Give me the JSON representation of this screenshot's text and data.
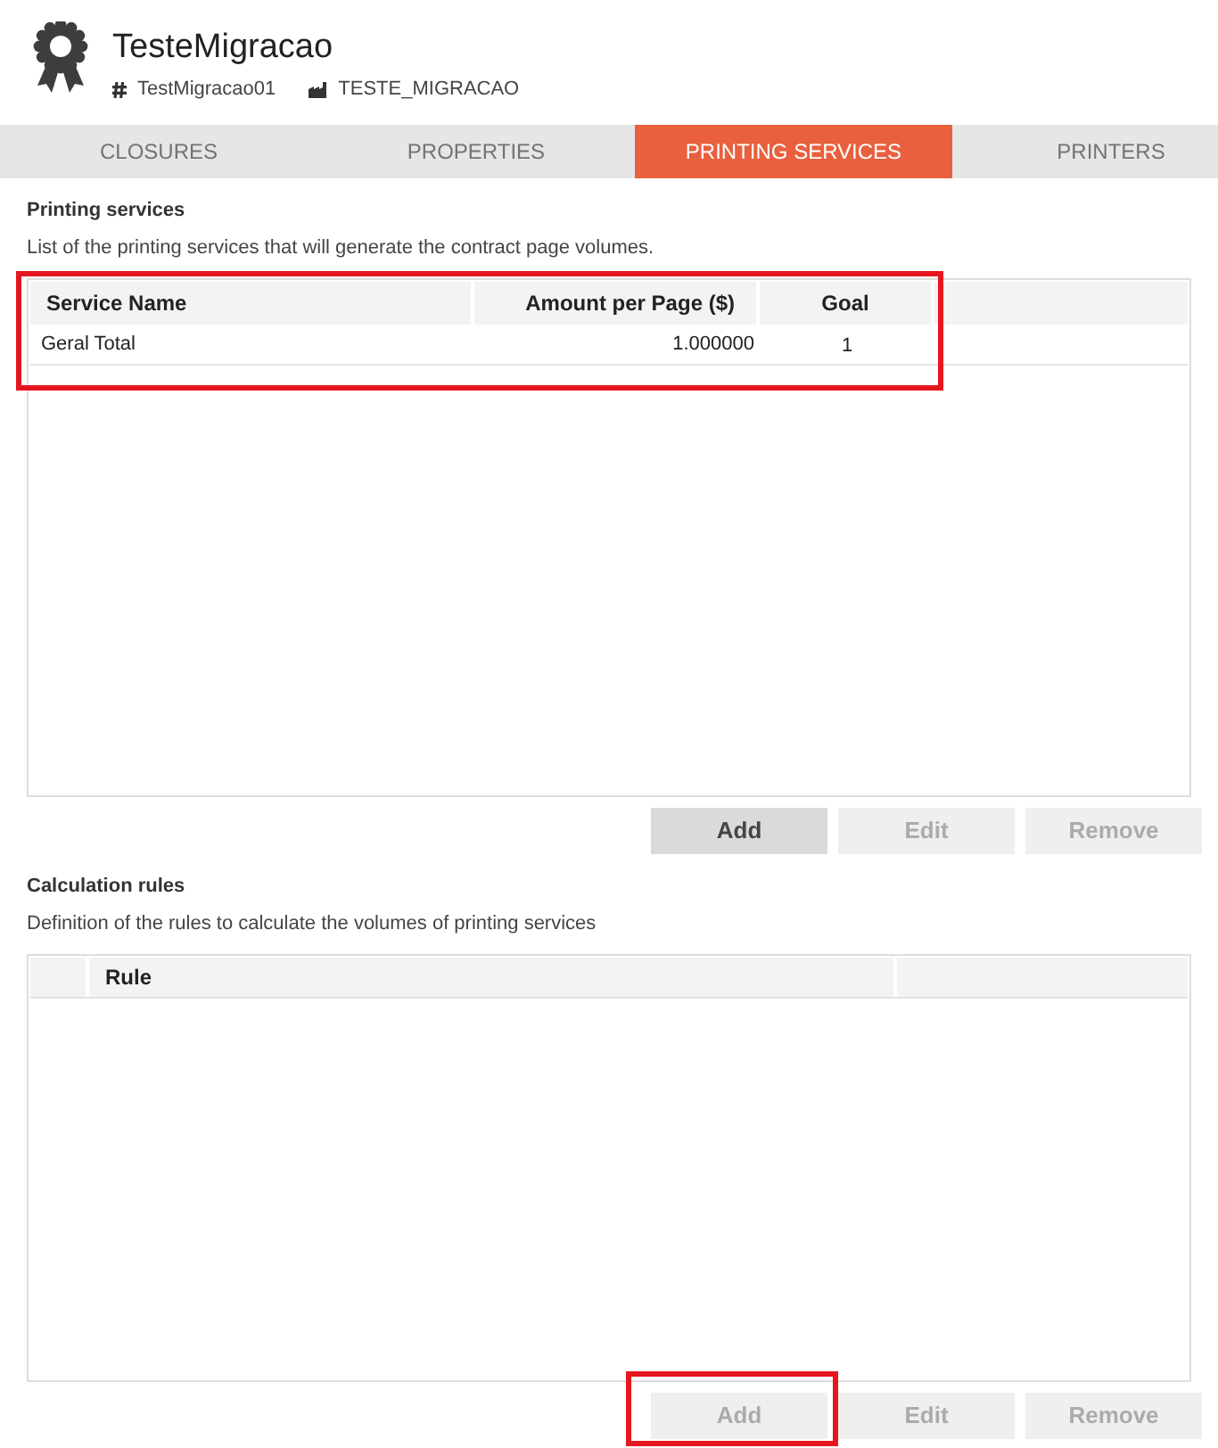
{
  "header": {
    "title": "TesteMigracao",
    "code": "TestMigracao01",
    "company": "TESTE_MIGRACAO"
  },
  "tabs": [
    {
      "label": "CLOSURES",
      "selected": false
    },
    {
      "label": "PROPERTIES",
      "selected": false
    },
    {
      "label": "PRINTING SERVICES",
      "selected": true
    },
    {
      "label": "PRINTERS",
      "selected": false
    }
  ],
  "sections": [
    {
      "title": "Printing services",
      "description": "List of the printing services that will generate the contract page volumes.",
      "table": {
        "kind": "services",
        "highlighted": true,
        "columns": [
          "Service Name",
          "Amount per Page ($)",
          "Goal"
        ],
        "rows": [
          [
            "Geral Total",
            "1.000000",
            "1"
          ]
        ]
      },
      "buttons": [
        {
          "label": "Add",
          "disabled": false,
          "highlighted": false
        },
        {
          "label": "Edit",
          "disabled": true,
          "highlighted": false
        },
        {
          "label": "Remove",
          "disabled": true,
          "highlighted": false
        }
      ]
    },
    {
      "title": "Calculation rules",
      "description": "Definition of the rules to calculate the volumes of printing services",
      "table": {
        "kind": "rules",
        "highlighted": false,
        "columns": [
          "Rule"
        ]
      },
      "buttons": [
        {
          "label": "Add",
          "disabled": true,
          "highlighted": true
        },
        {
          "label": "Edit",
          "disabled": true,
          "highlighted": false
        },
        {
          "label": "Remove",
          "disabled": true,
          "highlighted": false
        }
      ]
    }
  ]
}
